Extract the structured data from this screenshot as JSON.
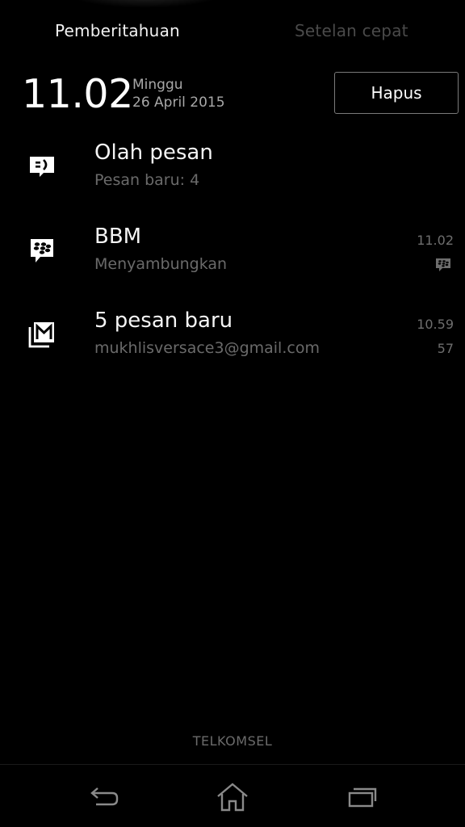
{
  "tabs": {
    "notifications": "Pemberitahuan",
    "quick_settings": "Setelan cepat"
  },
  "header": {
    "time": "11.02",
    "day": "Minggu",
    "date": "26 April 2015",
    "clear_label": "Hapus"
  },
  "notifications": [
    {
      "icon": "message-icon",
      "title": "Olah pesan",
      "subtitle": "Pesan baru: 4"
    },
    {
      "icon": "bbm-icon",
      "title": "BBM",
      "subtitle": "Menyambungkan",
      "time": "11.02",
      "small_icon": "bbm-small-icon"
    },
    {
      "icon": "gmail-icon",
      "title": "5 pesan baru",
      "subtitle": "mukhlisversace3@gmail.com",
      "time": "10.59",
      "count": "57"
    }
  ],
  "carrier": "TELKOMSEL",
  "navbar": {
    "back": "back-icon",
    "home": "home-icon",
    "recents": "recents-icon"
  }
}
